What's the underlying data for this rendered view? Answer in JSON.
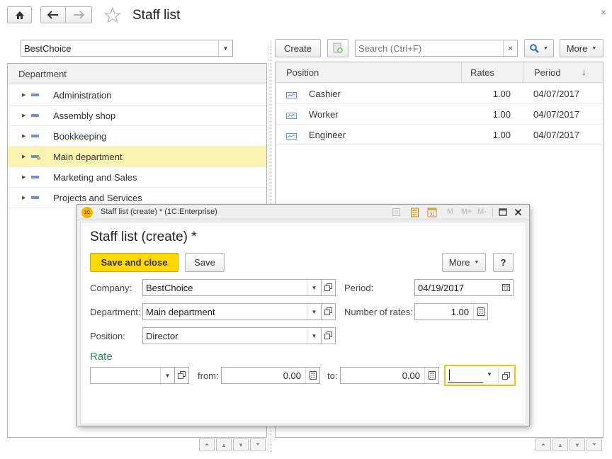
{
  "window": {
    "title": "Staff list",
    "close_glyph": "×"
  },
  "left": {
    "company": "BestChoice",
    "column_header": "Department",
    "departments": [
      {
        "label": "Administration"
      },
      {
        "label": "Assembly shop"
      },
      {
        "label": "Bookkeeping"
      },
      {
        "label": "Main department",
        "selected": true
      },
      {
        "label": "Marketing and Sales"
      },
      {
        "label": "Projects and Services"
      }
    ]
  },
  "right": {
    "toolbar": {
      "create_label": "Create",
      "search_placeholder": "Search (Ctrl+F)",
      "clear_glyph": "×",
      "more_label": "More"
    },
    "columns": {
      "position": "Position",
      "rates": "Rates",
      "period": "Period",
      "sort_glyph": "↓"
    },
    "rows": [
      {
        "position": "Cashier",
        "rates": "1.00",
        "period": "04/07/2017"
      },
      {
        "position": "Worker",
        "rates": "1.00",
        "period": "04/07/2017"
      },
      {
        "position": "Engineer",
        "rates": "1.00",
        "period": "04/07/2017"
      }
    ]
  },
  "dialog": {
    "caption": "Staff list (create) * (1C:Enterprise)",
    "app_badge": "1С",
    "toolbar_letters": {
      "m": "M",
      "mplus": "M+",
      "mminus": "M-"
    },
    "heading": "Staff list (create) *",
    "save_close_label": "Save and close",
    "save_label": "Save",
    "more_label": "More",
    "help_label": "?",
    "company_label": "Company:",
    "company_value": "BestChoice",
    "department_label": "Department:",
    "department_value": "Main department",
    "position_label": "Position:",
    "position_value": "Director",
    "period_label": "Period:",
    "period_value": "04/19/2017",
    "rates_label": "Number of rates:",
    "rates_value": "1.00",
    "rate_section": "Rate",
    "from_label": "from:",
    "from_value": "0.00",
    "to_label": "to:",
    "to_value": "0.00",
    "accent_color": "#2e8b57",
    "primary_color": "#ffd800"
  }
}
